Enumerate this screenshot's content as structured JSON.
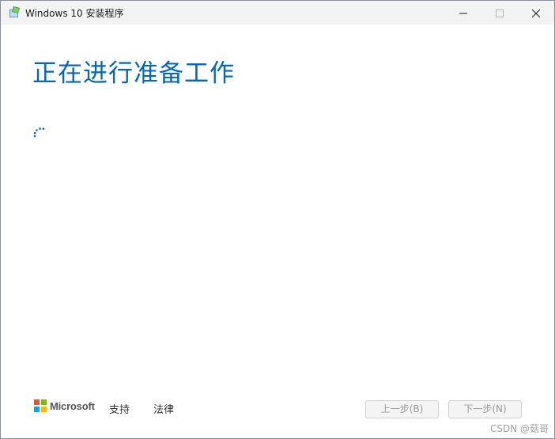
{
  "window": {
    "title": "Windows 10 安装程序"
  },
  "main": {
    "heading": "正在进行准备工作"
  },
  "footer": {
    "brand": "Microsoft",
    "support_link": "支持",
    "legal_link": "法律",
    "back_button": "上一步(B)",
    "next_button": "下一步(N)"
  },
  "watermark": "CSDN @菇哥",
  "colors": {
    "accent": "#0067c0",
    "ms_red": "#f25022",
    "ms_green": "#7fba00",
    "ms_blue": "#00a4ef",
    "ms_yellow": "#ffb900"
  },
  "icons": {
    "app": "setup-icon",
    "minimize": "minimize-icon",
    "maximize": "maximize-icon",
    "close": "close-icon",
    "loading": "loading-spinner-icon"
  }
}
